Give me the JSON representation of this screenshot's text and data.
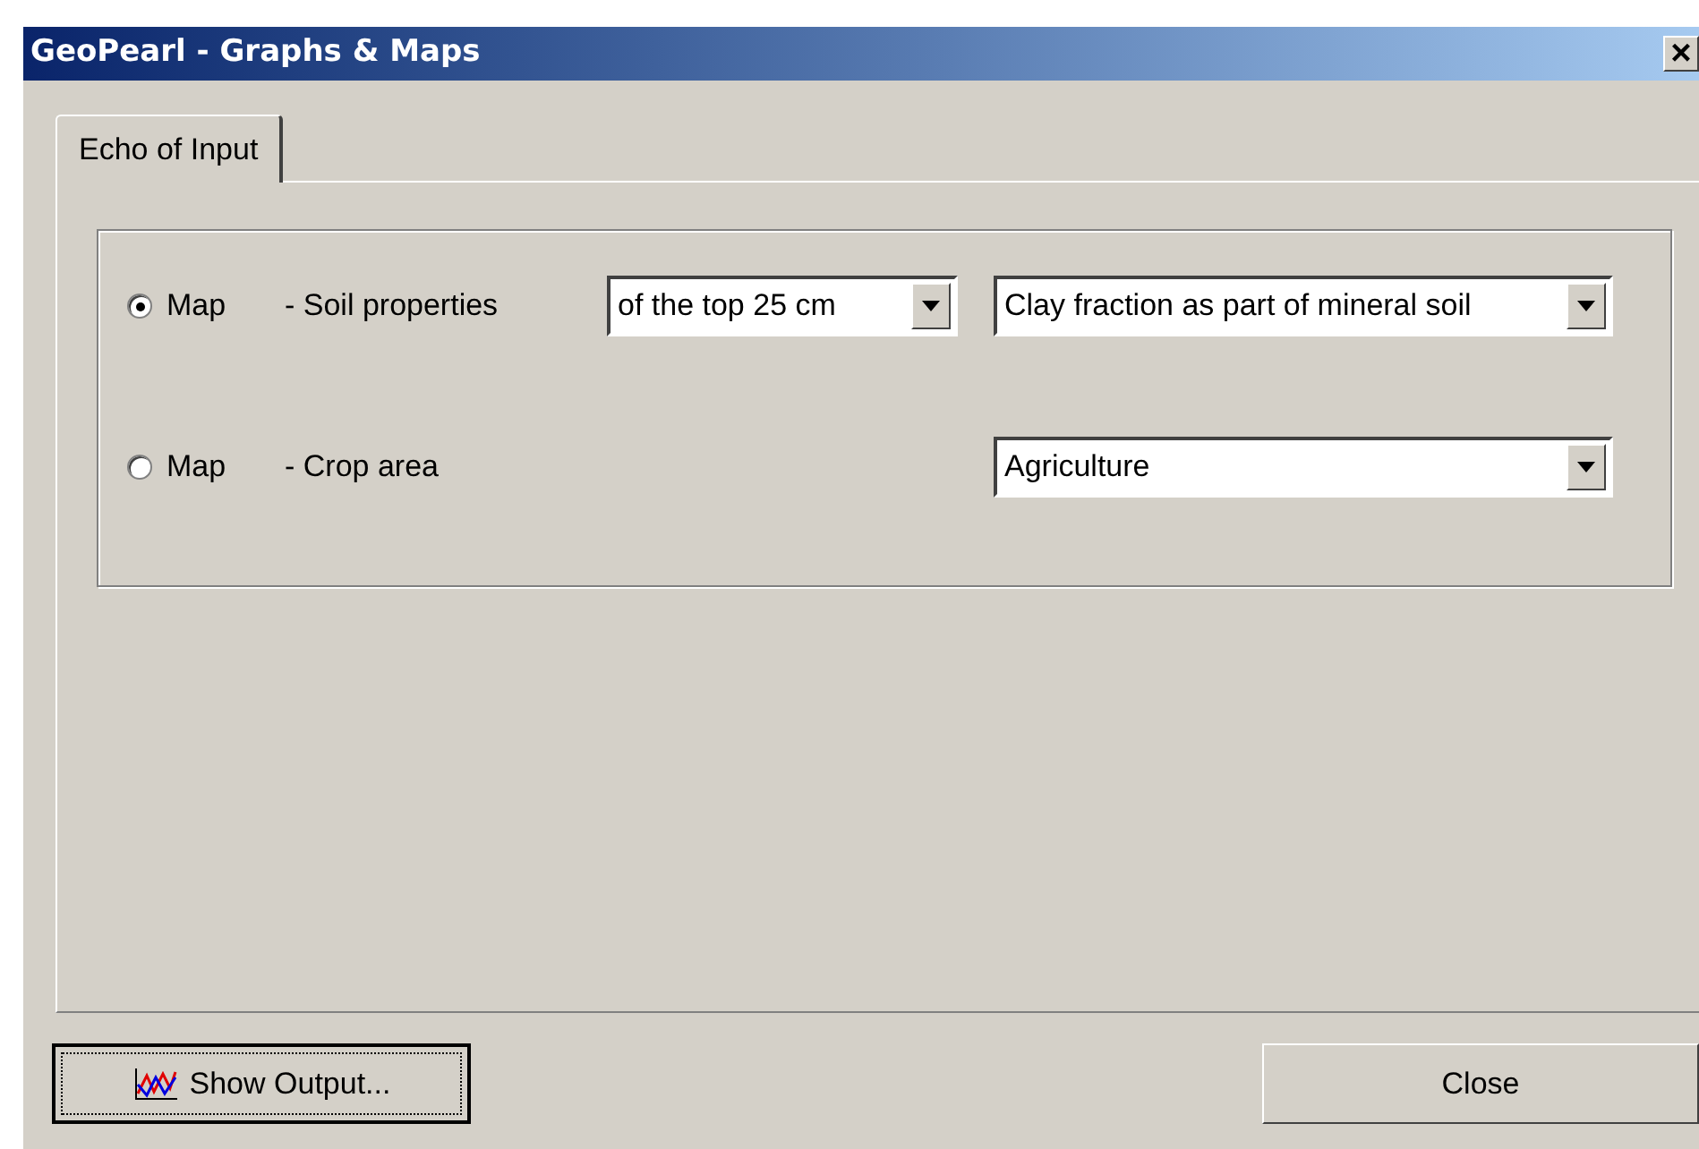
{
  "window": {
    "title": "GeoPearl - Graphs & Maps",
    "close_glyph": "×"
  },
  "tabs": [
    {
      "label": "Echo of Input",
      "selected": true
    }
  ],
  "options": [
    {
      "label": "Map",
      "description": "- Soil properties",
      "selected": true,
      "dropdowns": [
        {
          "value": "of the top 25 cm"
        },
        {
          "value": "Clay fraction as part of mineral soil"
        }
      ]
    },
    {
      "label": "Map",
      "description": "- Crop area",
      "selected": false,
      "dropdowns": [
        {
          "value": "Agriculture"
        }
      ]
    }
  ],
  "buttons": [
    {
      "kind": "show_output",
      "label": "Show Output...",
      "focused": true
    },
    {
      "kind": "close",
      "label": "Close",
      "focused": false
    }
  ]
}
